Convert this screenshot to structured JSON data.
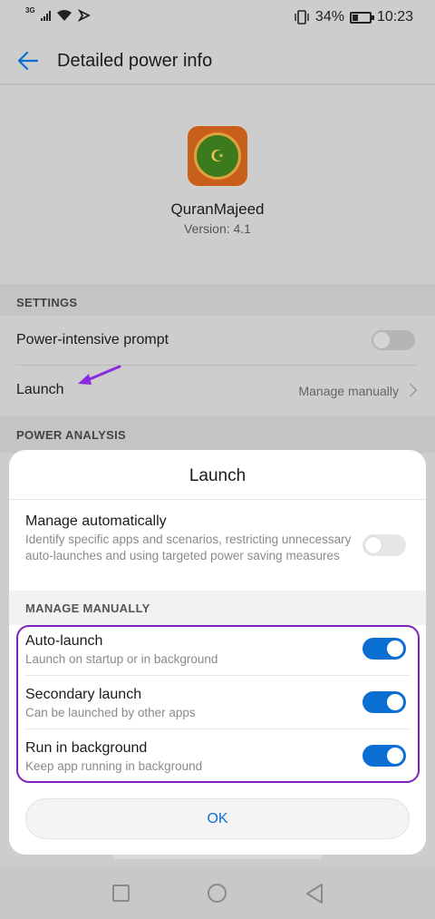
{
  "status_bar": {
    "network": "3G",
    "battery_percent": "34%",
    "time": "10:23"
  },
  "header": {
    "title": "Detailed power info"
  },
  "app": {
    "name": "QuranMajeed",
    "version": "Version: 4.1"
  },
  "settings": {
    "section_label": "SETTINGS",
    "power_prompt_label": "Power-intensive prompt",
    "power_prompt_on": false,
    "launch_label": "Launch",
    "launch_value": "Manage manually"
  },
  "power_analysis": {
    "section_label": "POWER ANALYSIS"
  },
  "dialog": {
    "title": "Launch",
    "auto_manage": {
      "title": "Manage automatically",
      "description": "Identify specific apps and scenarios, restricting unnecessary auto-launches and using targeted power saving measures",
      "on": false
    },
    "manual_section_label": "MANAGE MANUALLY",
    "options": [
      {
        "title": "Auto-launch",
        "description": "Launch on startup or in background",
        "on": true
      },
      {
        "title": "Secondary launch",
        "description": "Can be launched by other apps",
        "on": true
      },
      {
        "title": "Run in background",
        "description": "Keep app running in background",
        "on": true
      }
    ],
    "ok_label": "OK"
  },
  "colors": {
    "accent": "#0b6ed3",
    "highlight": "#7c22b8",
    "annotation_arrow": "#8a2be2"
  },
  "icons": {
    "back": "back-arrow-icon",
    "app": "quran-majeed-app-icon",
    "chevron": "chevron-right-icon",
    "nav_recent": "square-icon",
    "nav_home": "circle-icon",
    "nav_back": "triangle-back-icon"
  }
}
